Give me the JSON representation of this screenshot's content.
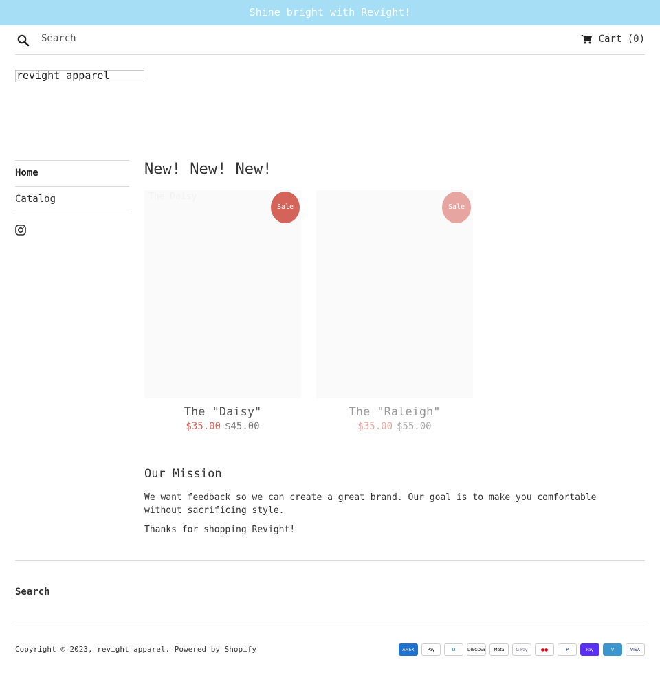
{
  "announcement": "Shine bright with Revight!",
  "header": {
    "search_placeholder": "Search",
    "cart_label": "Cart (0)"
  },
  "logo": "revight apparel",
  "nav": {
    "items": [
      {
        "label": "Home",
        "active": true
      },
      {
        "label": "Catalog",
        "active": false
      }
    ],
    "social_icon": "instagram-icon"
  },
  "collection": {
    "title": "New! New! New!",
    "products": [
      {
        "title": "The \"Daisy\"",
        "ghost_label": "The Daisy",
        "badge": "Sale",
        "price": "$35.00",
        "compare_price": "$45.00",
        "badge_color": "#d4635a",
        "price_color": "#d4635a",
        "compare_color": "#777777",
        "title_color": "#555555"
      },
      {
        "title": "The \"Raleigh\"",
        "badge": "Sale",
        "price": "$35.00",
        "compare_price": "$55.00",
        "badge_color": "#e6a5a0",
        "price_color": "#e6a5a0",
        "compare_color": "#aaaaaa",
        "title_color": "#999999"
      }
    ]
  },
  "mission": {
    "title": "Our Mission",
    "text": "We want feedback so we can create a great brand. Our goal is to make you comfortable without sacrificing style.",
    "thanks": "Thanks for shopping Revight!"
  },
  "footer": {
    "search_label": "Search",
    "copyright": "Copyright © 2023, revight apparel. Powered by Shopify",
    "payment_icons": [
      {
        "label": "AMEX",
        "name": "amex-icon",
        "bg": "#1f72cd",
        "fg": "#ffffff"
      },
      {
        "label": "Pay",
        "name": "apple-pay-icon",
        "bg": "#ffffff",
        "fg": "#000000"
      },
      {
        "label": "D",
        "name": "diners-club-icon",
        "bg": "#ffffff",
        "fg": "#0079be"
      },
      {
        "label": "DISCOVER",
        "name": "discover-icon",
        "bg": "#ffffff",
        "fg": "#000000"
      },
      {
        "label": "Meta",
        "name": "meta-pay-icon",
        "bg": "#ffffff",
        "fg": "#000000"
      },
      {
        "label": "G Pay",
        "name": "google-pay-icon",
        "bg": "#ffffff",
        "fg": "#5f6368"
      },
      {
        "label": "●●",
        "name": "mastercard-icon",
        "bg": "#ffffff",
        "fg": "#eb001b"
      },
      {
        "label": "P",
        "name": "paypal-icon",
        "bg": "#ffffff",
        "fg": "#003087"
      },
      {
        "label": "Pay",
        "name": "shop-pay-icon",
        "bg": "#5a31f4",
        "fg": "#ffffff"
      },
      {
        "label": "V",
        "name": "venmo-icon",
        "bg": "#3d95ce",
        "fg": "#ffffff"
      },
      {
        "label": "VISA",
        "name": "visa-icon",
        "bg": "#ffffff",
        "fg": "#1a1f71"
      }
    ]
  }
}
